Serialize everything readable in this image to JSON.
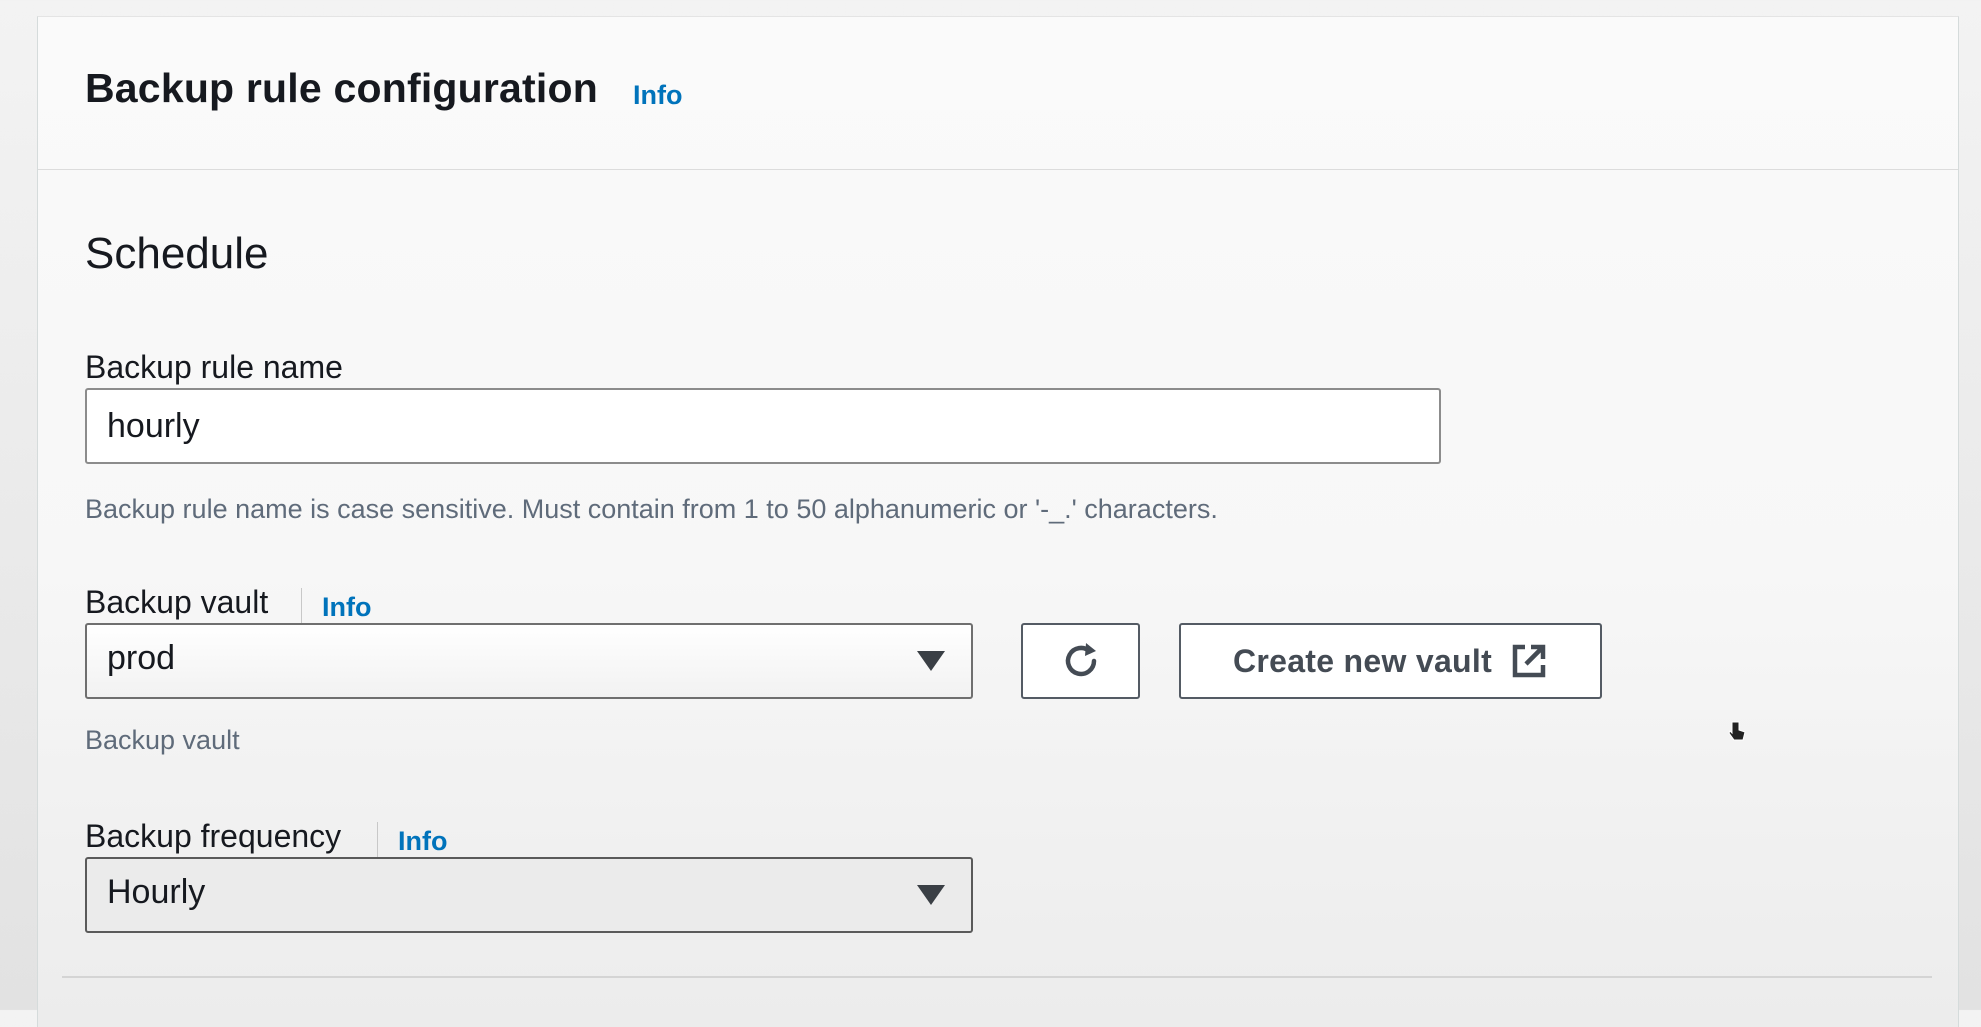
{
  "header": {
    "title": "Backup rule configuration",
    "info_label": "Info"
  },
  "schedule": {
    "title": "Schedule",
    "rule_name": {
      "label": "Backup rule name",
      "value": "hourly",
      "hint": "Backup rule name is case sensitive. Must contain from 1 to 50 alphanumeric or '-_.' characters."
    },
    "vault": {
      "label": "Backup vault",
      "info_label": "Info",
      "selected": "prod",
      "hint": "Backup vault",
      "refresh_icon": "refresh-icon",
      "create_button_label": "Create new vault",
      "create_button_icon": "external-link-icon"
    },
    "frequency": {
      "label": "Backup frequency",
      "info_label": "Info",
      "selected": "Hourly"
    }
  },
  "colors": {
    "link": "#0073bb",
    "text": "#16191f",
    "hint": "#5f6b7a",
    "button_text": "#444b54"
  }
}
